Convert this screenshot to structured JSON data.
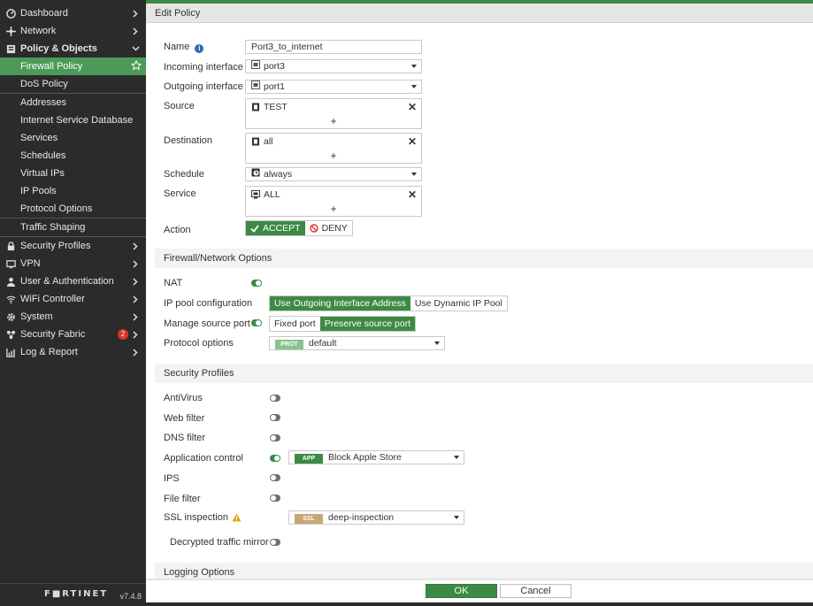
{
  "sidebar": {
    "items": [
      {
        "label": "Dashboard",
        "icon": "dashboard-icon"
      },
      {
        "label": "Network",
        "icon": "network-icon"
      },
      {
        "label": "Policy & Objects",
        "icon": "policy-icon"
      }
    ],
    "policy_sub": [
      "Firewall Policy",
      "DoS Policy"
    ],
    "objects_sub": [
      "Addresses",
      "Internet Service Database",
      "Services",
      "Schedules",
      "Virtual IPs",
      "IP Pools",
      "Protocol Options"
    ],
    "shaping_sub": "Traffic Shaping",
    "lower_items": [
      {
        "label": "Security Profiles"
      },
      {
        "label": "VPN"
      },
      {
        "label": "User & Authentication"
      },
      {
        "label": "WiFi Controller"
      },
      {
        "label": "System"
      },
      {
        "label": "Security Fabric",
        "badge": "2"
      },
      {
        "label": "Log & Report"
      }
    ],
    "logo": "F■RTINET",
    "version": "v7.4.8"
  },
  "header": {
    "title": "Edit Policy"
  },
  "form": {
    "name_label": "Name",
    "name_value": "Port3_to_internet",
    "incoming_label": "Incoming interface",
    "incoming_value": "port3",
    "outgoing_label": "Outgoing interface",
    "outgoing_value": "port1",
    "source_label": "Source",
    "source_value": "TEST",
    "destination_label": "Destination",
    "destination_value": "all",
    "schedule_label": "Schedule",
    "schedule_value": "always",
    "service_label": "Service",
    "service_value": "ALL",
    "action_label": "Action",
    "accept_label": "ACCEPT",
    "deny_label": "DENY",
    "plus": "+",
    "x": "✕"
  },
  "fw_options": {
    "title": "Firewall/Network Options",
    "nat_label": "NAT",
    "ippool_label": "IP pool configuration",
    "ippool_opt1": "Use Outgoing Interface Address",
    "ippool_opt2": "Use Dynamic IP Pool",
    "srcport_label": "Manage source port",
    "srcport_opt1": "Fixed port",
    "srcport_opt2": "Preserve source port",
    "protocol_label": "Protocol options",
    "protocol_tag": "PROT",
    "protocol_value": "default"
  },
  "sec_profiles": {
    "title": "Security Profiles",
    "antivirus": "AntiVirus",
    "webfilter": "Web filter",
    "dnsfilter": "DNS filter",
    "appcontrol": "Application control",
    "app_tag": "APP",
    "app_value": "Block Apple Store",
    "ips": "IPS",
    "filefilter": "File filter",
    "ssl": "SSL inspection",
    "ssl_tag": "SSL",
    "ssl_value": "deep-inspection",
    "mirror": "Decrypted traffic mirror"
  },
  "logging": {
    "title": "Logging Options"
  },
  "footer": {
    "ok": "OK",
    "cancel": "Cancel"
  },
  "colors": {
    "accent": "#3d8a45",
    "sidebar": "#2b2b2b",
    "warning": "#e8a317",
    "badge": "#d9342b"
  }
}
